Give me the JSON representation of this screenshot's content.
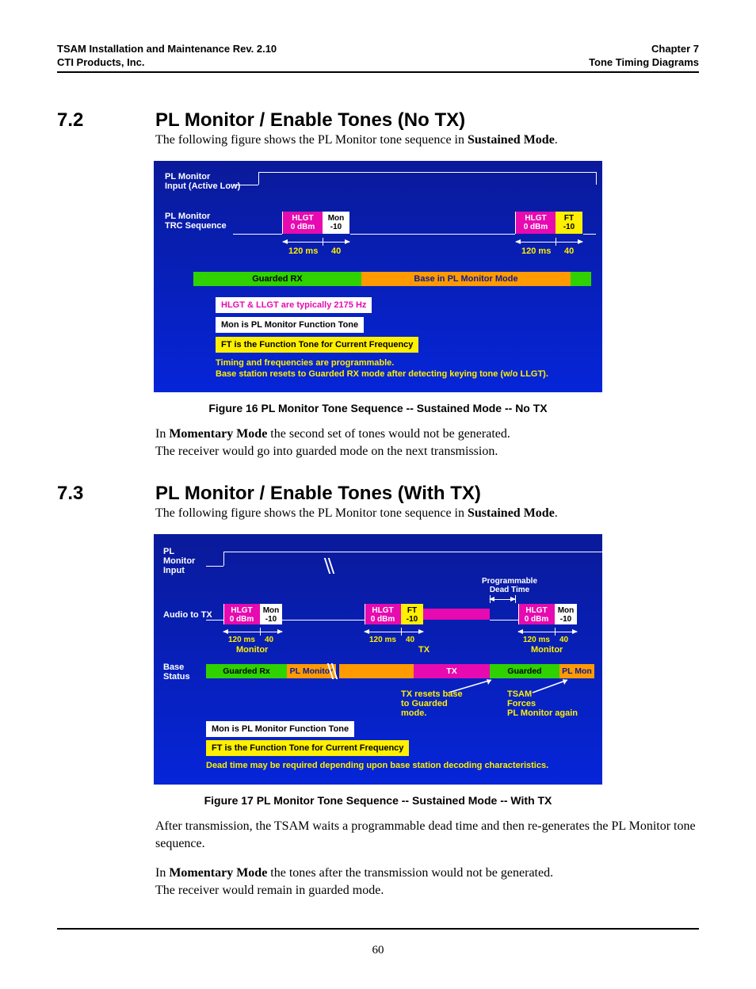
{
  "header": {
    "left1": "TSAM Installation and Maintenance Rev. 2.10",
    "left2": "CTI Products, Inc.",
    "right1": "Chapter 7",
    "right2": "Tone Timing Diagrams"
  },
  "section72": {
    "num": "7.2",
    "title": "PL Monitor / Enable Tones (No TX)",
    "intro_pre": "The following figure shows the PL Monitor tone sequence in ",
    "intro_bold": "Sustained Mode",
    "intro_post": ".",
    "momentary_bold": "Momentary Mode",
    "para2_a": "In ",
    "para2_b": " the second set of tones would not be generated.",
    "para3": "The receiver would go into guarded mode on the next transmission."
  },
  "fig16": {
    "caption": "Figure 16   PL Monitor Tone Sequence -- Sustained Mode -- No TX",
    "lbl_input": "PL Monitor\nInput (Active Low)",
    "lbl_trc": "PL Monitor\nTRC Sequence",
    "hlgt": "HLGT",
    "hlgt_db": "0 dBm",
    "mon": "Mon",
    "mon_db": "-10",
    "ft": "FT",
    "ft_db": "-10",
    "t120": "120 ms",
    "t40": "40",
    "bar_rx": "Guarded RX",
    "bar_mon": "Base in PL Monitor Mode",
    "note1": "HLGT & LLGT are typically 2175 Hz",
    "note2": "Mon is PL Monitor Function Tone",
    "note3": "FT is the Function Tone for Current Frequency",
    "note4a": "Timing and frequencies are programmable.",
    "note4b": "Base station resets to Guarded RX mode after detecting keying tone (w/o LLGT)."
  },
  "section73": {
    "num": "7.3",
    "title": "PL Monitor / Enable Tones (With TX)",
    "intro_pre": "The following figure shows the PL Monitor tone sequence in ",
    "intro_bold": "Sustained Mode",
    "intro_post": ".",
    "para2_a": "After transmission, the TSAM waits a programmable dead time and then re-generates the PL Monitor tone sequence.",
    "momentary_bold": "Momentary Mode",
    "para3_a": "In ",
    "para3_b": " the tones after the transmission would not be generated.",
    "para4": "The receiver would remain in guarded mode."
  },
  "fig17": {
    "caption": "Figure 17   PL Monitor Tone Sequence -- Sustained Mode -- With TX",
    "lbl_input": "PL\nMonitor\nInput",
    "lbl_audio": "Audio to TX",
    "lbl_base": "Base\nStatus",
    "dead": "Programmable\nDead Time",
    "hlgt": "HLGT",
    "hlgt_db": "0 dBm",
    "mon": "Mon",
    "mon_db": "-10",
    "ft": "FT",
    "ft_db": "-10",
    "t120": "120 ms",
    "t40": "40",
    "row_monitor": "Monitor",
    "row_tx": "TX",
    "bar_grx": "Guarded Rx",
    "bar_plmon": "PL Monitor",
    "bar_tx": "TX",
    "bar_guarded": "Guarded",
    "bar_plmon2": "PL Mon",
    "tx_resets": "TX resets base\nto Guarded\nmode.",
    "tsam": "TSAM\nForces\nPL Monitor again",
    "note1": "Mon is PL Monitor Function Tone",
    "note2": "FT is the Function Tone for Current Frequency",
    "note3": "Dead time may be required depending upon base station decoding characteristics."
  },
  "page_number": "60"
}
